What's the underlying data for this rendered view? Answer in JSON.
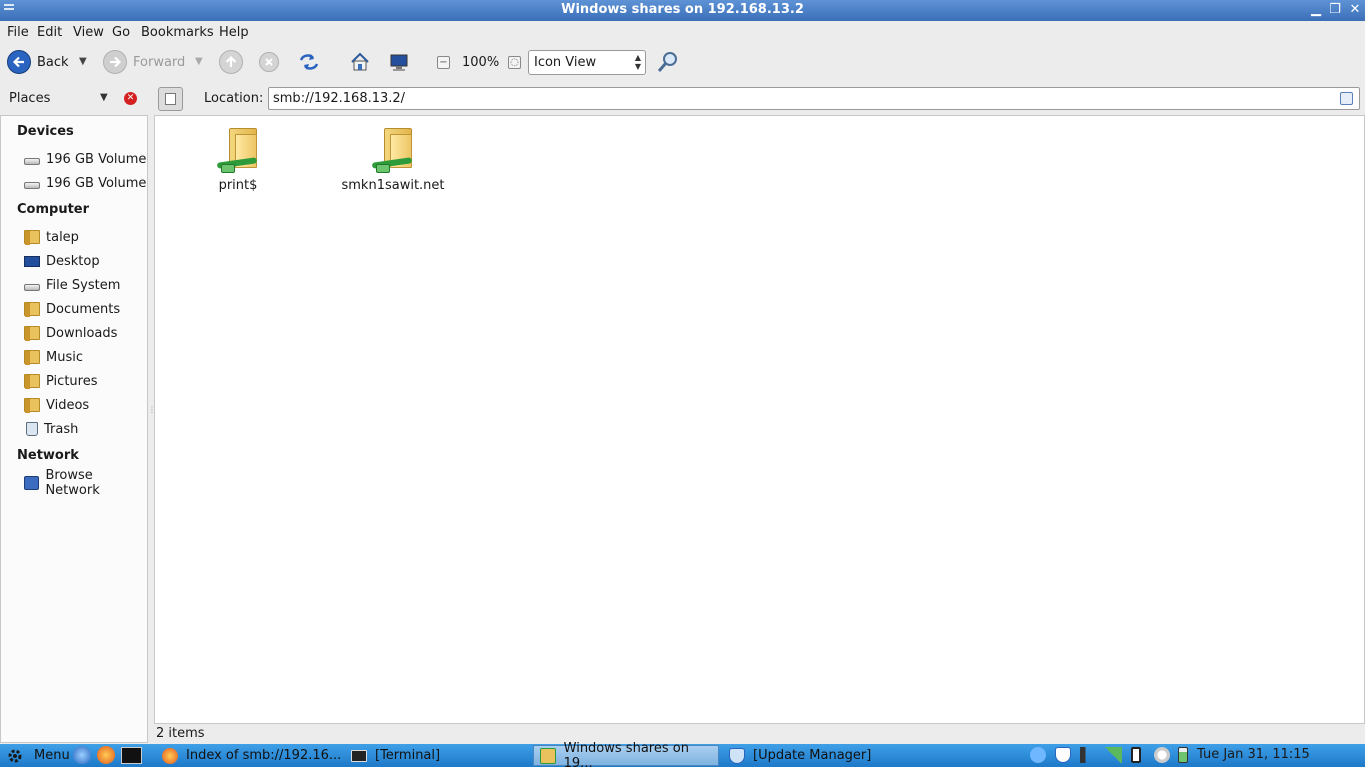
{
  "window": {
    "title": "Windows shares on 192.168.13.2",
    "minimize_glyph": "▁",
    "maximize_glyph": "❐",
    "close_glyph": "✕"
  },
  "menubar": [
    "File",
    "Edit",
    "View",
    "Go",
    "Bookmarks",
    "Help"
  ],
  "toolbar": {
    "back_label": "Back",
    "forward_label": "Forward",
    "zoom_level": "100%",
    "view_mode": "Icon View",
    "dropdown_glyph": "▼",
    "zoom_out_glyph": "−",
    "zoom_reset_glyph": "◌"
  },
  "places": {
    "label": "Places",
    "dropdown_glyph": "▼",
    "close_glyph": "✕"
  },
  "location": {
    "label": "Location:",
    "value": "smb://192.168.13.2/"
  },
  "sidebar": {
    "devices_heading": "Devices",
    "devices": [
      "196 GB Volume",
      "196 GB Volume"
    ],
    "computer_heading": "Computer",
    "computer": [
      "talep",
      "Desktop",
      "File System",
      "Documents",
      "Downloads",
      "Music",
      "Pictures",
      "Videos",
      "Trash"
    ],
    "network_heading": "Network",
    "network": [
      "Browse Network"
    ]
  },
  "files": [
    "print$",
    "smkn1sawit.net"
  ],
  "status": "2 items",
  "taskbar": {
    "menu_label": "Menu",
    "tasks": [
      "Index of smb://192.16...",
      "[Terminal]",
      "Windows shares on 19...",
      "[Update Manager]"
    ],
    "clock": "Tue Jan 31, 11:15"
  },
  "colors": {
    "titlebar": "#3a6fb8",
    "taskbar": "#1d79c9",
    "folder": "#e9c25d",
    "network_plug": "#2e9b3a"
  }
}
